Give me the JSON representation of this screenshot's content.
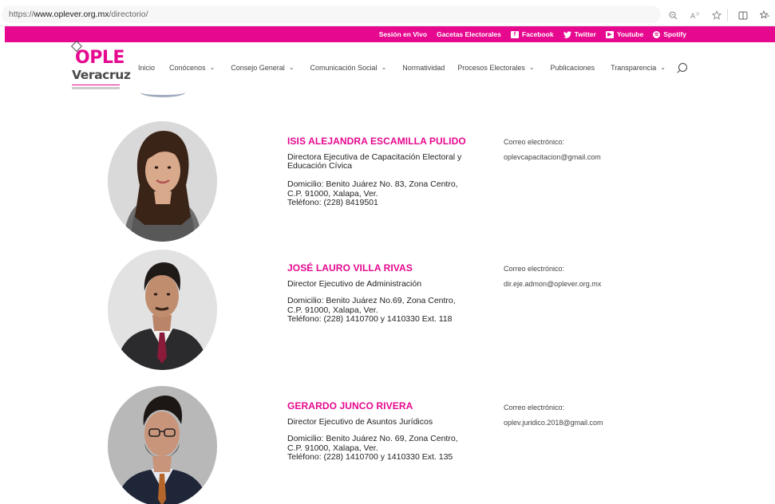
{
  "browser": {
    "url_prefix": "https://",
    "url_domain": "www.oplever.org.mx",
    "url_path": "/directorio/"
  },
  "topbar": {
    "items": [
      {
        "label": "Sesión en Vivo"
      },
      {
        "label": "Gacetas Electorales"
      },
      {
        "label": "Facebook",
        "icon": "facebook-icon"
      },
      {
        "label": "Twitter",
        "icon": "twitter-icon"
      },
      {
        "label": "Youtube",
        "icon": "youtube-icon"
      },
      {
        "label": "Spotify",
        "icon": "spotify-icon"
      }
    ],
    "color": "#e6088e"
  },
  "logo": {
    "top": "OPLE",
    "bottom": "Veracruz"
  },
  "nav": {
    "items": [
      {
        "label": "Inicio"
      },
      {
        "label": "Conócenos"
      },
      {
        "label": "Consejo General"
      },
      {
        "label": "Comunicación Social"
      },
      {
        "label": "Normatividad"
      },
      {
        "label": "Procesos Electorales"
      },
      {
        "label": "Publicaciones"
      },
      {
        "label": "Transparencia"
      }
    ]
  },
  "people": [
    {
      "name": "ISIS ALEJANDRA ESCAMILLA PULIDO",
      "role": "Directora Ejecutiva de Capacitación Electoral y Educación Cívica",
      "address_1": "Domicilio: Benito Juárez No. 83, Zona Centro,",
      "address_2": "C.P. 91000, Xalapa, Ver.",
      "phone": "Teléfono: (228) 8419501",
      "email_label": "Correo electrónico:",
      "email": "oplevcapacitacion@gmail.com"
    },
    {
      "name": "JOSÉ LAURO VILLA RIVAS",
      "role": "Director Ejecutivo de Administración",
      "address_1": "Domicilio: Benito Juárez No.69, Zona Centro,",
      "address_2": "C.P. 91000, Xalapa, Ver.",
      "phone": "Teléfono: (228) 1410700 y 1410330 Ext. 118",
      "email_label": "Correo electrónico:",
      "email": "dir.eje.admon@oplever.org.mx"
    },
    {
      "name": "GERARDO JUNCO RIVERA",
      "role": "Director Ejecutivo de Asuntos Jurídicos",
      "address_1": "Domicilio: Benito Juárez No. 69, Zona Centro,",
      "address_2": "C.P. 91000, Xalapa, Ver.",
      "phone": "Teléfono: (228) 1410700 y 1410330 Ext. 135",
      "email_label": "Correo electrónico:",
      "email": "oplev.juridico.2018@gmail.com"
    }
  ],
  "colors": {
    "accent": "#e6088e",
    "text": "#222222"
  }
}
